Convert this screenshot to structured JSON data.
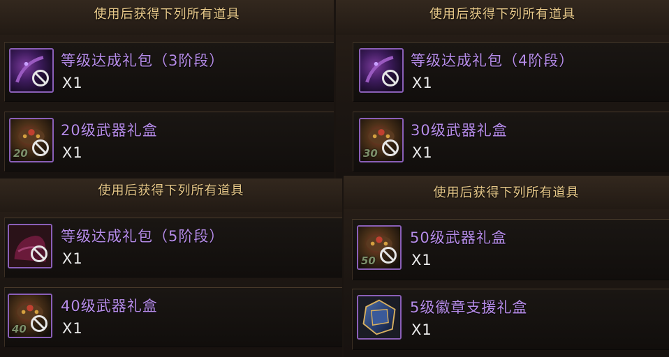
{
  "panels": [
    {
      "title": "使用后获得下列所有道具",
      "items": [
        {
          "name": "等级达成礼包（3阶段）",
          "qty": "X1",
          "icon": "gift-pack-icon",
          "level": ""
        },
        {
          "name": "20级武器礼盒",
          "qty": "X1",
          "icon": "weapon-box-icon",
          "level": "20"
        }
      ]
    },
    {
      "title": "使用后获得下列所有道具",
      "items": [
        {
          "name": "等级达成礼包（4阶段）",
          "qty": "X1",
          "icon": "gift-pack-icon",
          "level": ""
        },
        {
          "name": "30级武器礼盒",
          "qty": "X1",
          "icon": "weapon-box-icon",
          "level": "30"
        }
      ]
    },
    {
      "title": "使用后获得下列所有道具",
      "items": [
        {
          "name": "等级达成礼包（5阶段）",
          "qty": "X1",
          "icon": "gift-pack-icon",
          "level": ""
        },
        {
          "name": "40级武器礼盒",
          "qty": "X1",
          "icon": "weapon-box-icon",
          "level": "40"
        }
      ]
    },
    {
      "title": "使用后获得下列所有道具",
      "items": [
        {
          "name": "50级武器礼盒",
          "qty": "X1",
          "icon": "weapon-box-icon",
          "level": "50"
        },
        {
          "name": "5级徽章支援礼盒",
          "qty": "X1",
          "icon": "emblem-box-icon",
          "level": ""
        }
      ]
    }
  ],
  "colors": {
    "title": "#e8c98a",
    "item_name": "#b68ce8",
    "quantity": "#ececec",
    "icon_border": "#8a5fb8"
  }
}
